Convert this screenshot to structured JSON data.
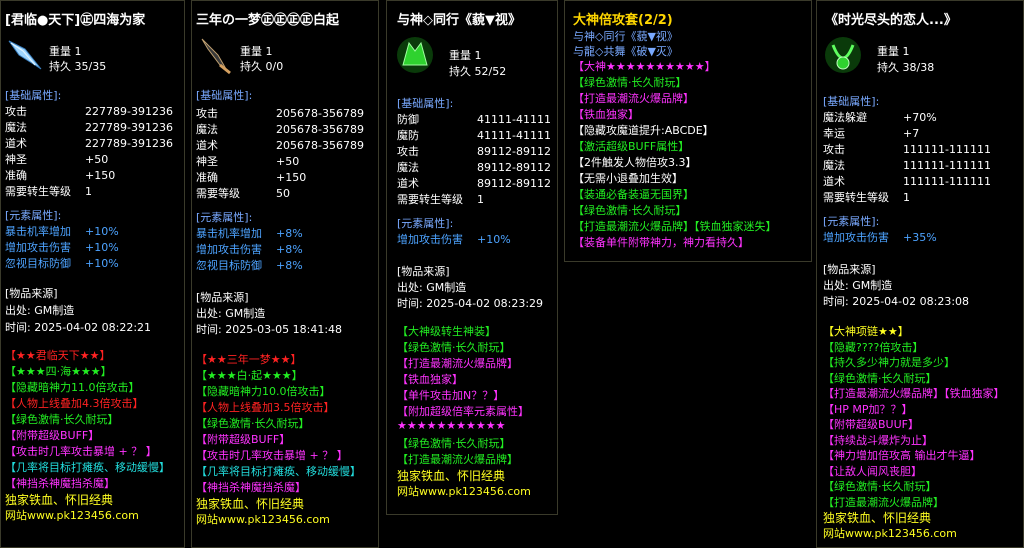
{
  "colors": {
    "gold": "#ffd700",
    "green": "#22ee22",
    "magenta": "#ff33ff",
    "red": "#ff2222",
    "yellow": "#ffff22",
    "cyan": "#22dddd",
    "blue": "#79a9ff"
  },
  "p1": {
    "title": "[君临●天下]㊣四海为家",
    "weight": "重量 1",
    "durability": "持久 35/35",
    "base_header": "[基础属性]:",
    "stats": [
      [
        "攻击",
        "227789-391236"
      ],
      [
        "魔法",
        "227789-391236"
      ],
      [
        "道术",
        "227789-391236"
      ],
      [
        "神圣",
        "+50"
      ],
      [
        "准确",
        "+150"
      ],
      [
        "需要转生等级",
        "1"
      ]
    ],
    "elem_header": "[元素属性]:",
    "elems": [
      [
        "暴击机率增加",
        "+10%"
      ],
      [
        "增加攻击伤害",
        "+10%"
      ],
      [
        "忽视目标防御",
        "+10%"
      ]
    ],
    "source_header": "[物品来源]",
    "origin": "出处: GM制造",
    "time": "时间: 2025-04-02 08:22:21",
    "lines": [
      {
        "t": "【★★君临天下★★】",
        "c": "r"
      },
      {
        "t": "【★★★四·海★★★】",
        "c": "g"
      },
      {
        "t": "【隐藏暗神力11.0倍攻击】",
        "c": "g"
      },
      {
        "t": "【人物上线叠加4.3倍攻击】",
        "c": "r"
      },
      {
        "t": "【绿色激情·长久耐玩】",
        "c": "g"
      },
      {
        "t": "【附带超级BUFF】",
        "c": "m"
      },
      {
        "t": "【攻击时几率攻击暴增 + ？ 】",
        "c": "m"
      },
      {
        "t": "【几率将目标打瘫痪、移动缓慢】",
        "c": "c"
      },
      {
        "t": "【神挡杀神魔挡杀魔】",
        "c": "m"
      },
      {
        "t": "独家铁血、怀旧经典",
        "c": "y"
      },
      {
        "t": "网站www.pk123456.com",
        "c": "y"
      }
    ]
  },
  "p2": {
    "title": "三年の一梦㊣㊣㊣㊣白起",
    "weight": "重量 1",
    "durability": "持久 0/0",
    "base_header": "[基础属性]:",
    "stats": [
      [
        "攻击",
        "205678-356789"
      ],
      [
        "魔法",
        "205678-356789"
      ],
      [
        "道术",
        "205678-356789"
      ],
      [
        "神圣",
        "+50"
      ],
      [
        "准确",
        "+150"
      ],
      [
        "需要等级",
        "50"
      ]
    ],
    "elem_header": "[元素属性]:",
    "elems": [
      [
        "暴击机率增加",
        "+8%"
      ],
      [
        "增加攻击伤害",
        "+8%"
      ],
      [
        "忽视目标防御",
        "+8%"
      ]
    ],
    "source_header": "[物品来源]",
    "origin": "出处: GM制造",
    "time": "时间: 2025-03-05 18:41:48",
    "lines": [
      {
        "t": "【★★三年一梦★★】",
        "c": "r"
      },
      {
        "t": "【★★★白·起★★★】",
        "c": "g"
      },
      {
        "t": "【隐藏暗神力10.0倍攻击】",
        "c": "g"
      },
      {
        "t": "【人物上线叠加3.5倍攻击】",
        "c": "r"
      },
      {
        "t": "【绿色激情·长久耐玩】",
        "c": "g"
      },
      {
        "t": "【附带超级BUFF】",
        "c": "m"
      },
      {
        "t": "【攻击时几率攻击暴增 + ？ 】",
        "c": "m"
      },
      {
        "t": "【几率将目标打瘫痪、移动缓慢】",
        "c": "c"
      },
      {
        "t": "【神挡杀神魔挡杀魔】",
        "c": "m"
      },
      {
        "t": "独家铁血、怀旧经典",
        "c": "y"
      },
      {
        "t": "网站www.pk123456.com",
        "c": "y"
      }
    ]
  },
  "p3": {
    "title": "与神◇同行《藐▼视》",
    "weight": "重量 1",
    "durability": "持久 52/52",
    "base_header": "[基础属性]:",
    "stats": [
      [
        "防御",
        "41111-41111"
      ],
      [
        "魔防",
        "41111-41111"
      ],
      [
        "攻击",
        "89112-89112"
      ],
      [
        "魔法",
        "89112-89112"
      ],
      [
        "道术",
        "89112-89112"
      ],
      [
        "需要转生等级",
        "1"
      ]
    ],
    "elem_header": "[元素属性]:",
    "elems": [
      [
        "增加攻击伤害",
        "+10%"
      ]
    ],
    "source_header": "[物品来源]",
    "origin": "出处: GM制造",
    "time": "时间: 2025-04-02 08:23:29",
    "lines": [
      {
        "t": "【大神级转生神装】",
        "c": "g"
      },
      {
        "t": "【绿色激情·长久耐玩】",
        "c": "g"
      },
      {
        "t": "【打造最潮流火爆品牌】",
        "c": "m"
      },
      {
        "t": "【铁血独家】",
        "c": "m"
      },
      {
        "t": "【单件攻击加N？？】",
        "c": "m"
      },
      {
        "t": "【附加超级倍率元素属性】",
        "c": "m"
      },
      {
        "t": "★★★★★★★★★★★",
        "c": "m"
      },
      {
        "t": "【绿色激情·长久耐玩】",
        "c": "g"
      },
      {
        "t": "【打造最潮流火爆品牌】",
        "c": "g"
      },
      {
        "t": "独家铁血、怀旧经典",
        "c": "y"
      },
      {
        "t": "网站www.pk123456.com",
        "c": "y"
      }
    ]
  },
  "p4": {
    "title": "大神倍攻套(2/2)",
    "lines": [
      {
        "t": "与神◇同行《藐▼视》",
        "c": "rv"
      },
      {
        "t": "与龍◇共舞《破▼灭》",
        "c": "rv"
      },
      {
        "t": "【大神★★★★★★★★★★】",
        "c": "m"
      },
      {
        "t": "【绿色激情·长久耐玩】",
        "c": "g"
      },
      {
        "t": "【打造最潮流火爆品牌】",
        "c": "m"
      },
      {
        "t": "【铁血独家】",
        "c": "m"
      },
      {
        "t": "【隐藏攻魔道提升:ABCDE】",
        "c": "w"
      },
      {
        "t": "【激活超级BUFF属性】",
        "c": "g"
      },
      {
        "t": "【2件触发人物倍攻3.3】",
        "c": "w"
      },
      {
        "t": "【无需小退叠加生效】",
        "c": "w"
      },
      {
        "t": "【装通必备装逼无国界】",
        "c": "g"
      },
      {
        "t": "【绿色激情·长久耐玩】",
        "c": "g"
      },
      {
        "t": "【打造最潮流火爆品牌】【铁血独家迷失】",
        "c": "g"
      },
      {
        "t": "【装备单件附带神力，神力看持久】",
        "c": "m"
      }
    ]
  },
  "p5": {
    "title": "《时光尽头的恋人...》",
    "weight": "重量 1",
    "durability": "持久 38/38",
    "base_header": "[基础属性]:",
    "stats": [
      [
        "魔法躲避",
        "+70%"
      ],
      [
        "幸运",
        "+7"
      ],
      [
        "攻击",
        "111111-111111"
      ],
      [
        "魔法",
        "111111-111111"
      ],
      [
        "道术",
        "111111-111111"
      ],
      [
        "需要转生等级",
        "1"
      ]
    ],
    "elem_header": "[元素属性]:",
    "elems": [
      [
        "增加攻击伤害",
        "+35%"
      ]
    ],
    "source_header": "[物品来源]",
    "origin": "出处: GM制造",
    "time": "时间: 2025-04-02 08:23:08",
    "lines": [
      {
        "t": "【大神项链★★】",
        "c": "y"
      },
      {
        "t": "【隐藏????倍攻击】",
        "c": "g"
      },
      {
        "t": "【持久多少神力就是多少】",
        "c": "g"
      },
      {
        "t": "【绿色激情·长久耐玩】",
        "c": "g"
      },
      {
        "t": "【打造最潮流火爆品牌】【铁血独家】",
        "c": "m"
      },
      {
        "t": "【HP MP加？？】",
        "c": "m"
      },
      {
        "t": "【附带超级BUUF】",
        "c": "m"
      },
      {
        "t": "【持续战斗爆炸为止】",
        "c": "m"
      },
      {
        "t": "【神力增加倍攻高 输出才牛逼】",
        "c": "m"
      },
      {
        "t": "【让敌人闻风丧胆】",
        "c": "m"
      },
      {
        "t": "【绿色激情·长久耐玩】",
        "c": "g"
      },
      {
        "t": "【打造最潮流火爆品牌】",
        "c": "g"
      },
      {
        "t": "独家铁血、怀旧经典",
        "c": "y"
      },
      {
        "t": "网站www.pk123456.com",
        "c": "y"
      }
    ]
  }
}
